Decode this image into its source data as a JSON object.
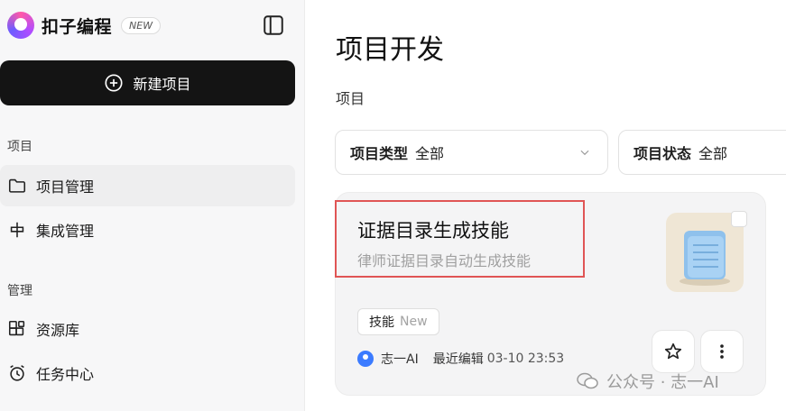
{
  "brand": {
    "name": "扣子编程",
    "badge": "NEW"
  },
  "sidebar": {
    "new_button": "新建项目",
    "sections": [
      {
        "label": "项目",
        "items": [
          {
            "label": "项目管理",
            "icon": "folder-icon",
            "active": true
          },
          {
            "label": "集成管理",
            "icon": "integration-icon",
            "active": false
          }
        ]
      },
      {
        "label": "管理",
        "items": [
          {
            "label": "资源库",
            "icon": "resource-grid-icon",
            "active": false
          },
          {
            "label": "任务中心",
            "icon": "alarm-clock-icon",
            "active": false
          }
        ]
      }
    ]
  },
  "main": {
    "title": "项目开发",
    "subtitle": "项目",
    "filters": [
      {
        "label": "项目类型",
        "value": "全部"
      },
      {
        "label": "项目状态",
        "value": "全部"
      }
    ],
    "card": {
      "title": "证据目录生成技能",
      "description": "律师证据目录自动生成技能",
      "tag": "技能",
      "tag_badge": "New",
      "author": "志一AI",
      "edit_label": "最近编辑",
      "edit_time": "03-10 23:53",
      "highlight_color": "#e05555"
    }
  },
  "watermark": {
    "text": "公众号 · 志一AI"
  }
}
